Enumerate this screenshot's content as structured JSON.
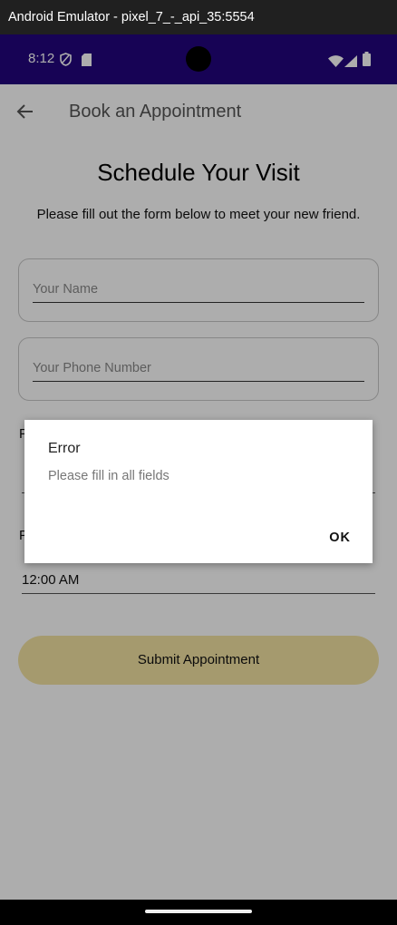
{
  "emulator": {
    "title": "Android Emulator - pixel_7_-_api_35:5554"
  },
  "status_bar": {
    "time": "8:12"
  },
  "app_bar": {
    "title": "Book an Appointment"
  },
  "form": {
    "heading": "Schedule Your Visit",
    "subheading": "Please fill out the form below to meet your new friend.",
    "name_placeholder": "Your Name",
    "phone_placeholder": "Your Phone Number",
    "date_label_partial": "P",
    "time_label_partial": "P",
    "time_value": "12:00 AM",
    "submit_label": "Submit Appointment"
  },
  "dialog": {
    "title": "Error",
    "message": "Please fill in all fields",
    "ok_label": "OK"
  },
  "colors": {
    "status_bar": "#22057e",
    "submit_button": "#f3e3a3",
    "emulator_titlebar": "#202020"
  }
}
